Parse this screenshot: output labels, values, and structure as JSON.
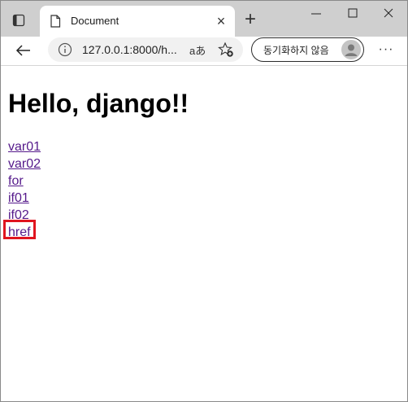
{
  "tab": {
    "title": "Document"
  },
  "address_bar": {
    "url": "127.0.0.1:8000/h..."
  },
  "toolbar": {
    "read_aloud": "aあ",
    "sync_label": "동기화하지 않음"
  },
  "page": {
    "heading": "Hello, django!!",
    "links": [
      "var01",
      "var02",
      "for",
      "if01",
      "if02",
      "href"
    ]
  },
  "colors": {
    "link_visited": "#551a8b",
    "highlight": "#e0151f",
    "titlebar": "#cfcfcf"
  },
  "icons": [
    "tab-actions-icon",
    "document-icon",
    "close-icon",
    "plus-icon",
    "minimize-icon",
    "maximize-icon",
    "window-close-icon",
    "back-arrow-icon",
    "info-icon",
    "favorite-add-icon",
    "avatar-icon",
    "more-icon"
  ]
}
